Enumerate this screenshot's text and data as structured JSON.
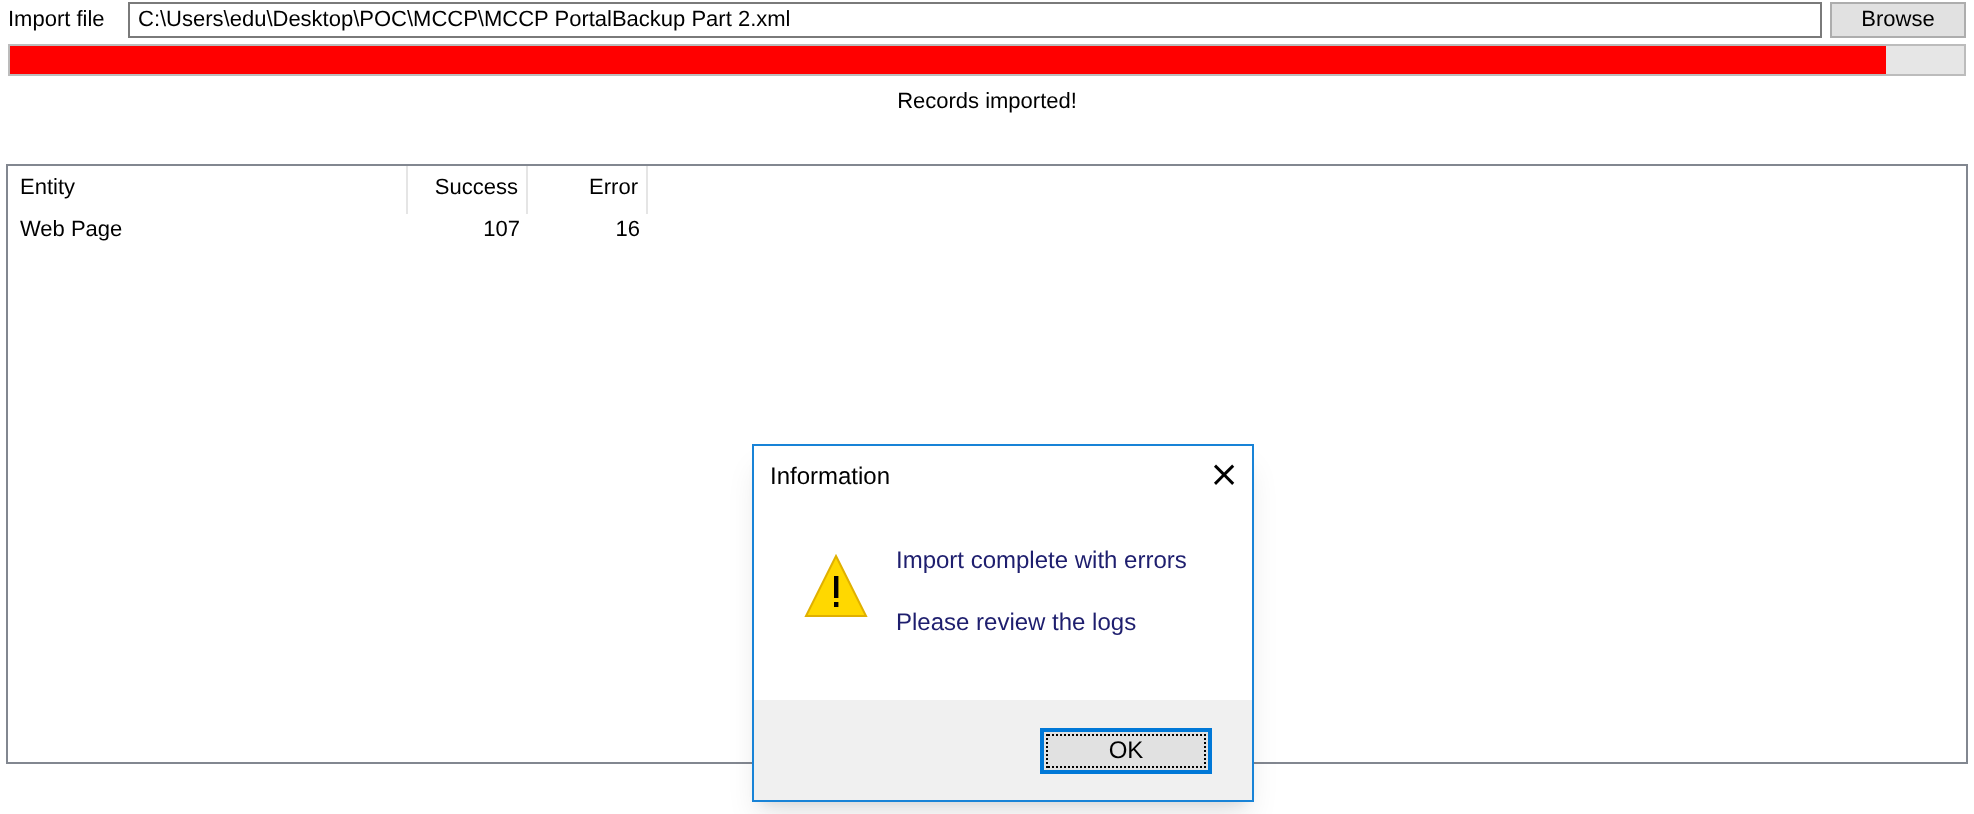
{
  "import_file": {
    "label": "Import file",
    "value": "C:\\Users\\edu\\Desktop\\POC\\MCCP\\MCCP PortalBackup Part 2.xml",
    "button": "Browse"
  },
  "progress": {
    "level": 0.96
  },
  "status": "Records imported!",
  "table": {
    "columns": [
      "Entity",
      "Success",
      "Error"
    ],
    "rows": [
      {
        "cells": [
          "Web Page",
          "107",
          "16"
        ]
      }
    ]
  },
  "dialog": {
    "title": "Information",
    "close": "×",
    "lines": [
      "Import complete with errors",
      "Please review the logs"
    ],
    "button": "OK"
  }
}
